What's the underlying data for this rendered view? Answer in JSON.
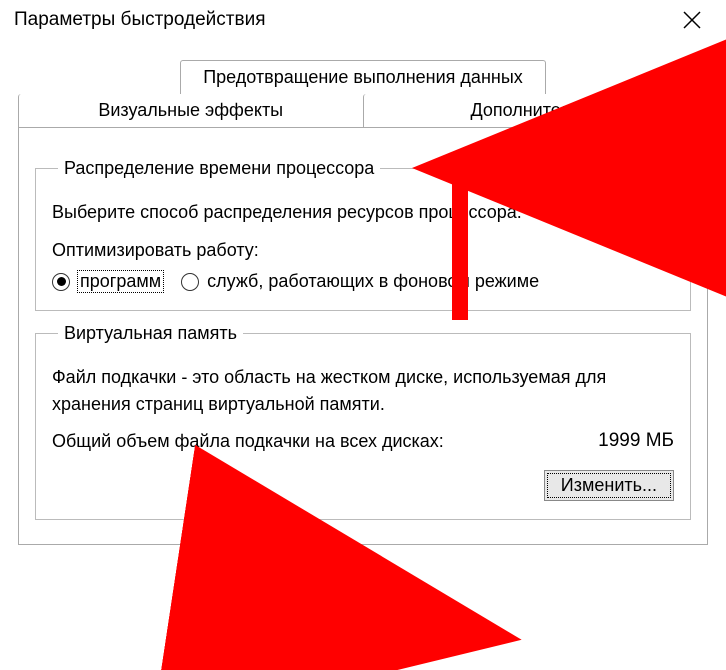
{
  "window": {
    "title": "Параметры быстродействия"
  },
  "tabs": {
    "dep": "Предотвращение выполнения данных",
    "visual": "Визуальные эффекты",
    "advanced": "Дополнительно"
  },
  "scheduling": {
    "legend": "Распределение времени процессора",
    "desc": "Выберите способ распределения ресурсов процессора.",
    "optimize_label": "Оптимизировать работу:",
    "radio_programs": "программ",
    "radio_services": "служб, работающих в фоновом режиме"
  },
  "vmem": {
    "legend": "Виртуальная память",
    "desc": "Файл подкачки - это область на жестком диске, используемая для хранения страниц виртуальной памяти.",
    "total_label": "Общий объем файла подкачки на всех дисках:",
    "total_value": "1999 МБ",
    "change_button": "Изменить..."
  }
}
